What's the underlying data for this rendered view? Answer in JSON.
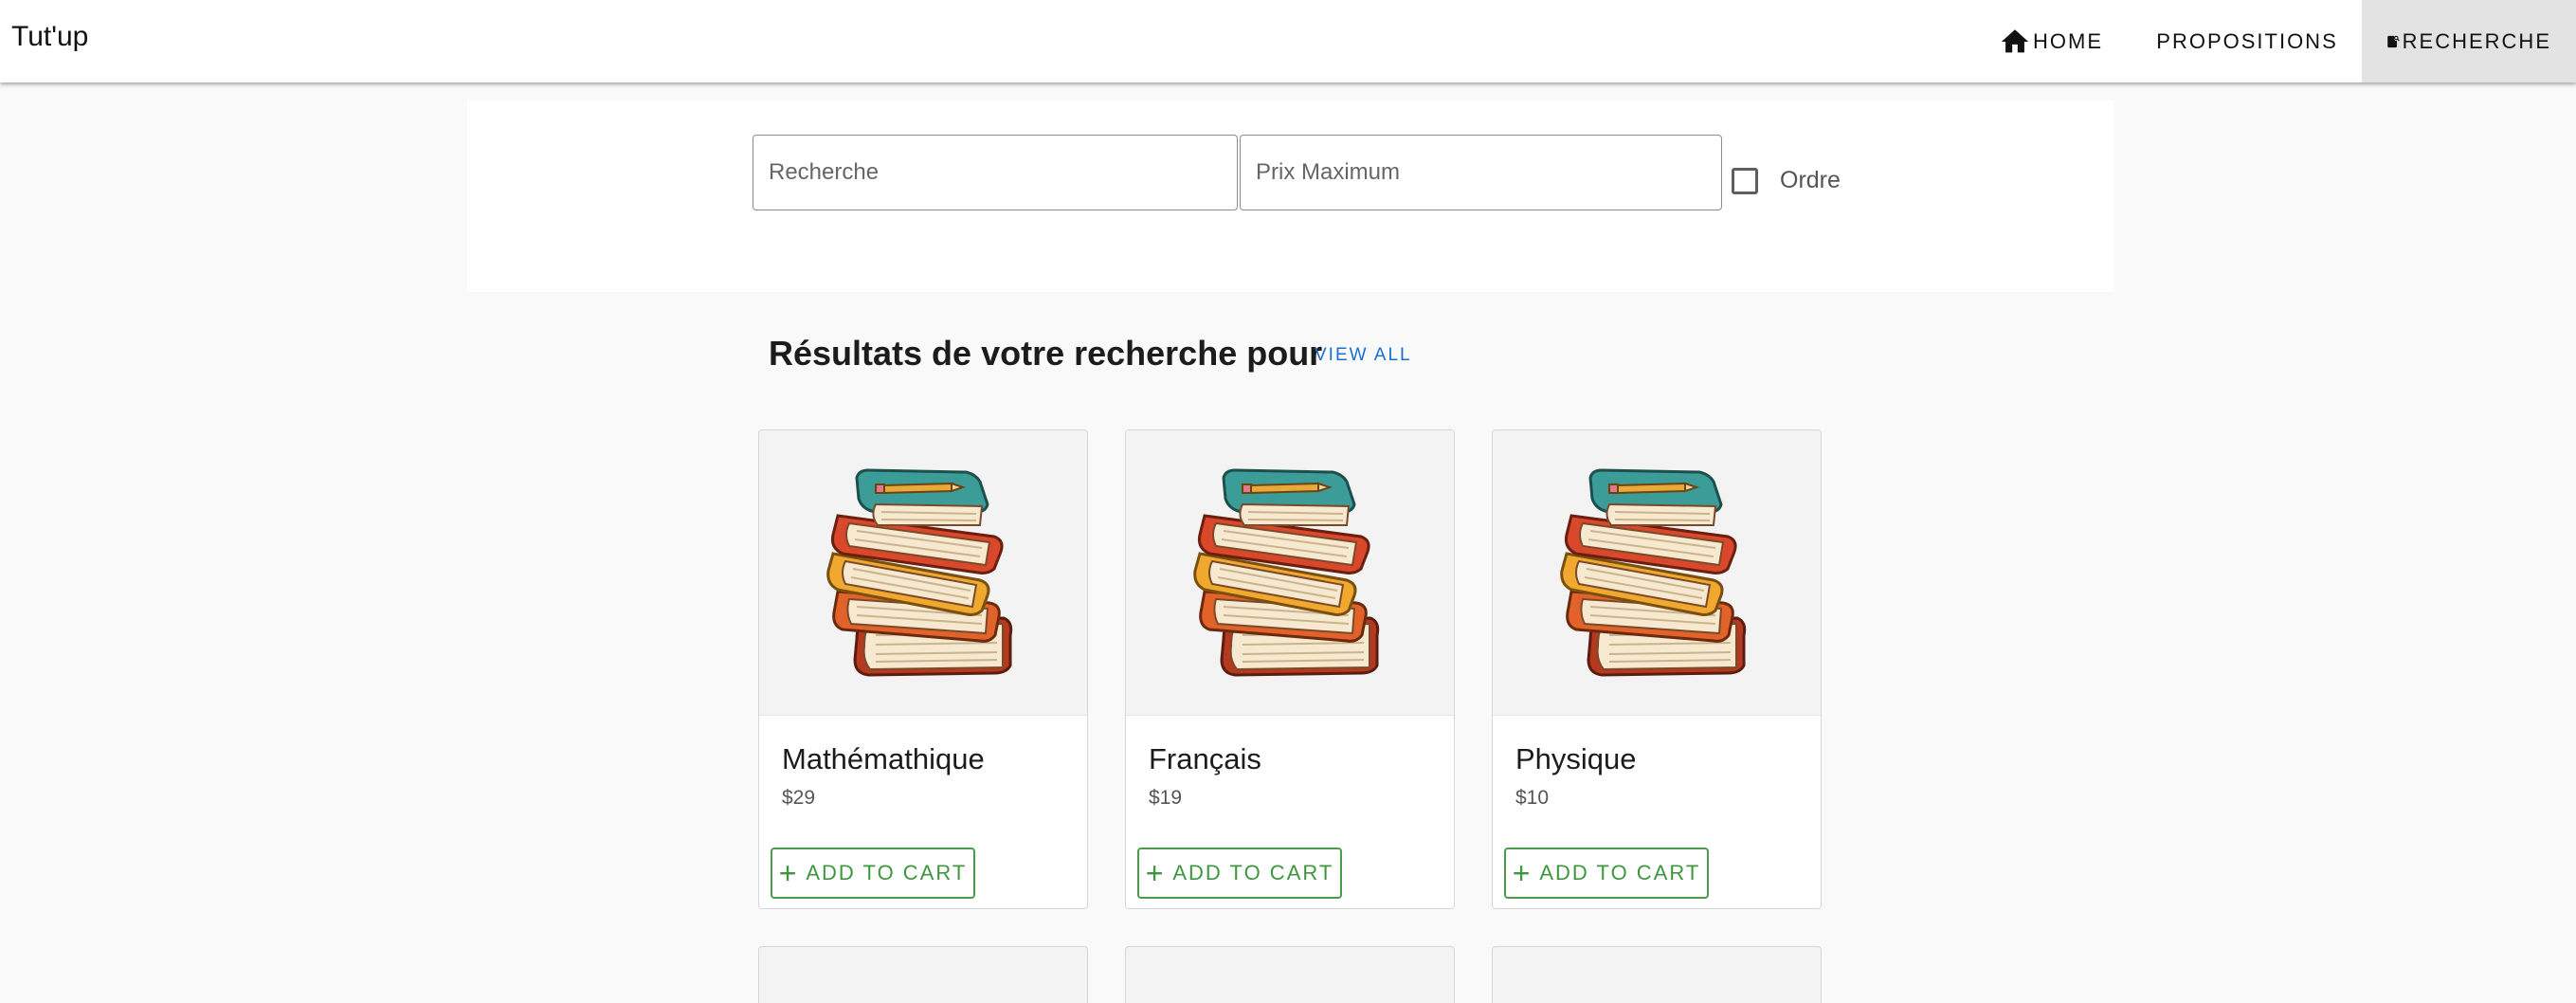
{
  "app": {
    "title": "Tut'up"
  },
  "nav": {
    "items": [
      {
        "label": "HOME",
        "icon": "home-icon"
      },
      {
        "label": "PROPOSITIONS",
        "icon": "cart-icon"
      },
      {
        "label": "RECHERCHE",
        "icon": "search-doc-icon",
        "active": true
      }
    ]
  },
  "search": {
    "query_placeholder": "Recherche",
    "query_value": "",
    "price_placeholder": "Prix Maximum",
    "price_value": "",
    "order_label": "Ordre",
    "order_checked": false
  },
  "results": {
    "title": "Résultats de votre recherche pour",
    "view_all": "VIEW ALL",
    "products": [
      {
        "name": "Mathémathique",
        "price": "$29",
        "button": "ADD TO CART",
        "image": "books-stack-illustration"
      },
      {
        "name": "Français",
        "price": "$19",
        "button": "ADD TO CART",
        "image": "books-stack-illustration"
      },
      {
        "name": "Physique",
        "price": "$10",
        "button": "ADD TO CART",
        "image": "books-stack-illustration"
      }
    ]
  },
  "colors": {
    "accent_green": "#3f963f",
    "link_blue": "#1a6fcf",
    "active_tab_bg": "#e3e3e3",
    "page_bg": "#f9f9f9"
  }
}
